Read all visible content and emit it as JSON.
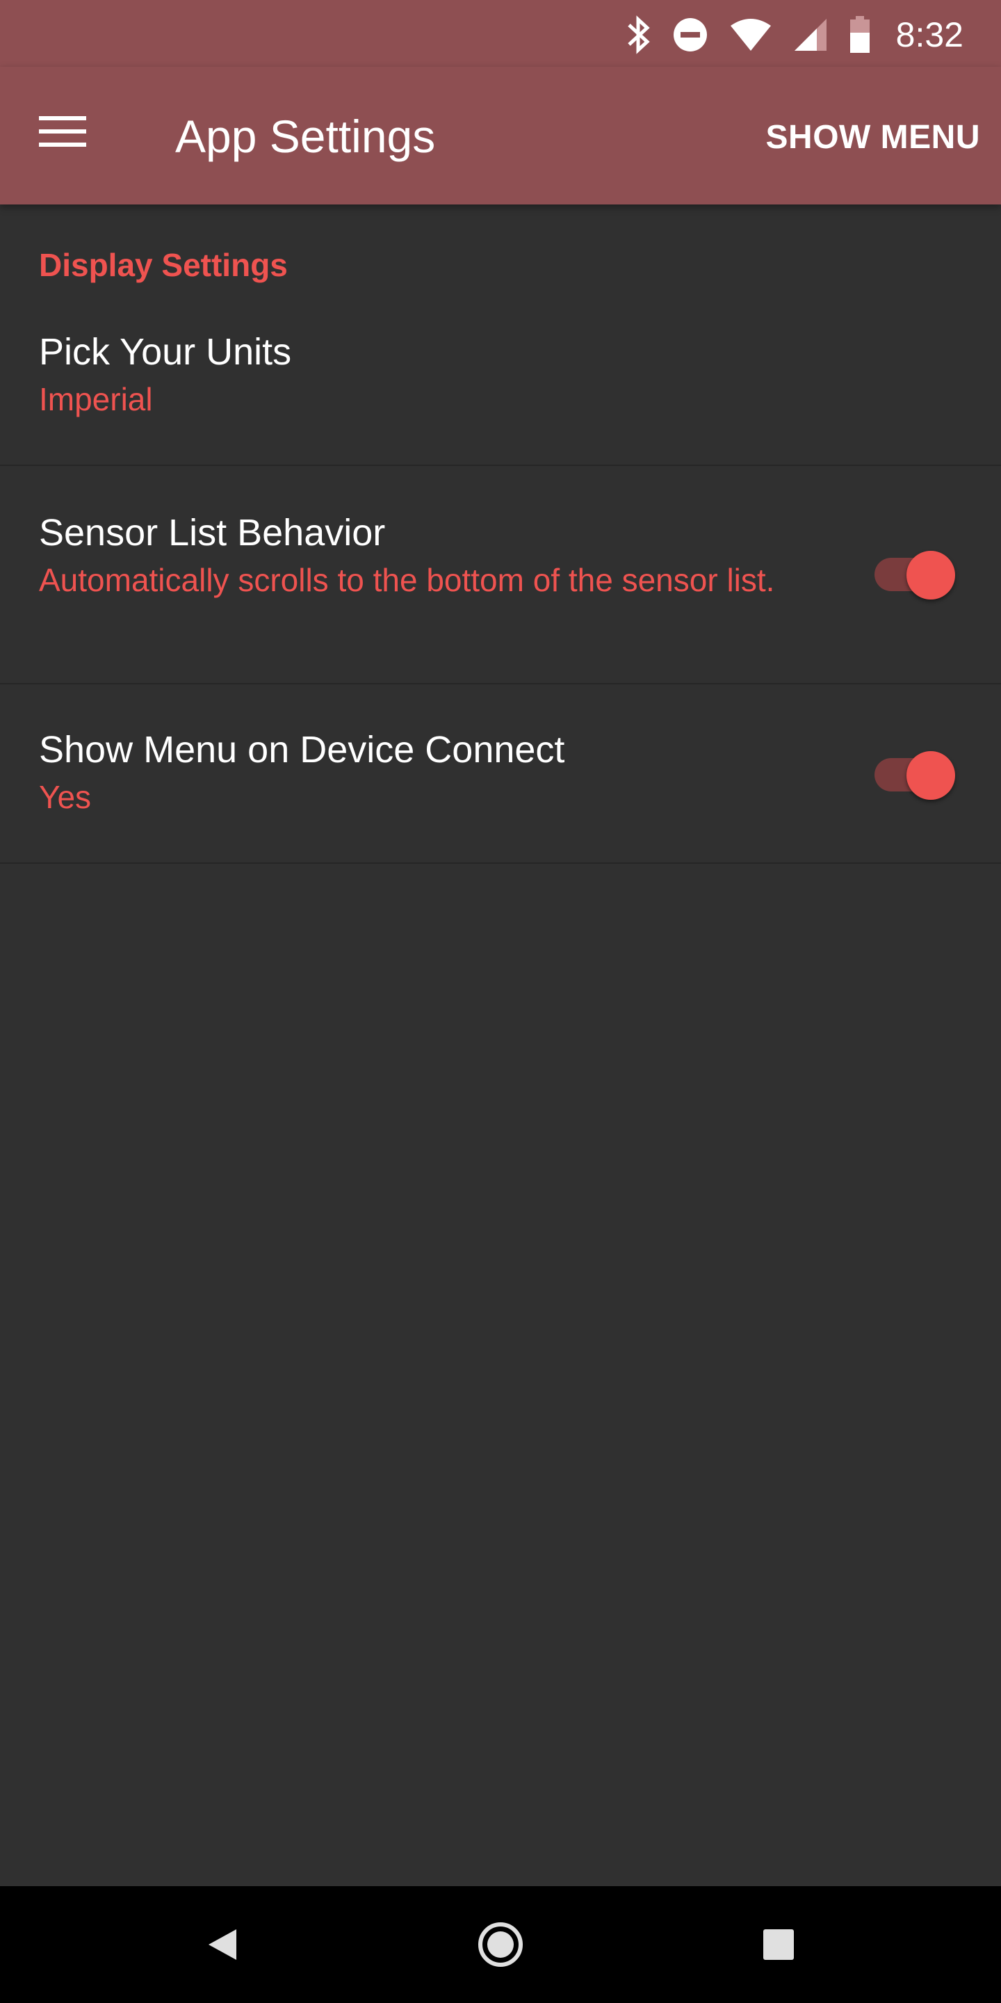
{
  "status_bar": {
    "time": "8:32",
    "icons": [
      "bluetooth-icon",
      "do-not-disturb-icon",
      "wifi-icon",
      "cell-signal-icon",
      "battery-icon"
    ]
  },
  "app_bar": {
    "menu_icon": "hamburger-menu-icon",
    "title": "App Settings",
    "action_label": "SHOW MENU"
  },
  "settings": {
    "section_title": "Display Settings",
    "units": {
      "title": "Pick Your Units",
      "summary": "Imperial"
    },
    "sensor_list": {
      "title": "Sensor List Behavior",
      "summary": "Automatically scrolls to the bottom of the sensor list.",
      "enabled": true
    },
    "show_menu": {
      "title": "Show Menu on Device Connect",
      "summary": "Yes",
      "enabled": true
    }
  },
  "nav_bar": {
    "buttons": [
      "back-icon",
      "home-icon",
      "recents-icon"
    ]
  },
  "colors": {
    "app_bar": "#8e4f52",
    "background": "#303030",
    "accent": "#ef5350",
    "switch_track": "#7a3c3d",
    "nav_bar": "#000000"
  }
}
